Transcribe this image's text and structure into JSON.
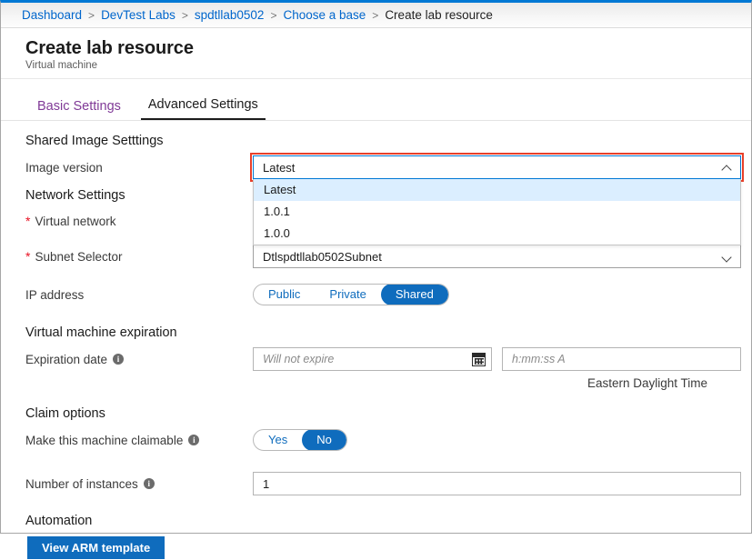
{
  "breadcrumb": {
    "items": [
      {
        "label": "Dashboard",
        "current": false
      },
      {
        "label": "DevTest Labs",
        "current": false
      },
      {
        "label": "spdtllab0502",
        "current": false
      },
      {
        "label": "Choose a base",
        "current": false
      },
      {
        "label": "Create lab resource",
        "current": true
      }
    ],
    "separator": ">"
  },
  "header": {
    "title": "Create lab resource",
    "subtitle": "Virtual machine"
  },
  "tabs": [
    {
      "label": "Basic Settings",
      "active": false
    },
    {
      "label": "Advanced Settings",
      "active": true
    }
  ],
  "sections": {
    "shared_image": {
      "heading": "Shared Image Setttings",
      "image_version": {
        "label": "Image version",
        "value": "Latest",
        "expanded": true,
        "options": [
          "Latest",
          "1.0.1",
          "1.0.0"
        ],
        "selected_option": "Latest"
      }
    },
    "network": {
      "heading": "Network Settings",
      "virtual_network": {
        "label": "Virtual network",
        "required": true,
        "value": ""
      },
      "subnet_selector": {
        "label": "Subnet Selector",
        "required": true,
        "value": "Dtlspdtllab0502Subnet"
      },
      "ip_address": {
        "label": "IP address",
        "options": [
          "Public",
          "Private",
          "Shared"
        ],
        "selected": "Shared"
      }
    },
    "expiration": {
      "heading": "Virtual machine expiration",
      "date": {
        "label": "Expiration date",
        "placeholder": "Will not expire",
        "value": ""
      },
      "time": {
        "placeholder": "h:mm:ss A",
        "value": ""
      },
      "timezone": "Eastern Daylight Time"
    },
    "claim": {
      "heading": "Claim options",
      "claimable": {
        "label": "Make this machine claimable",
        "options": [
          "Yes",
          "No"
        ],
        "selected": "No"
      },
      "instances": {
        "label": "Number of instances",
        "value": "1"
      }
    },
    "automation": {
      "heading": "Automation",
      "view_arm_label": "View ARM template"
    }
  },
  "colors": {
    "accent": "#0f6cbd",
    "link": "#0066cc",
    "tab_inactive": "#803a97",
    "required": "#e81123",
    "highlight_outline": "#e8402a",
    "dropdown_selected_bg": "#dbeeff"
  }
}
